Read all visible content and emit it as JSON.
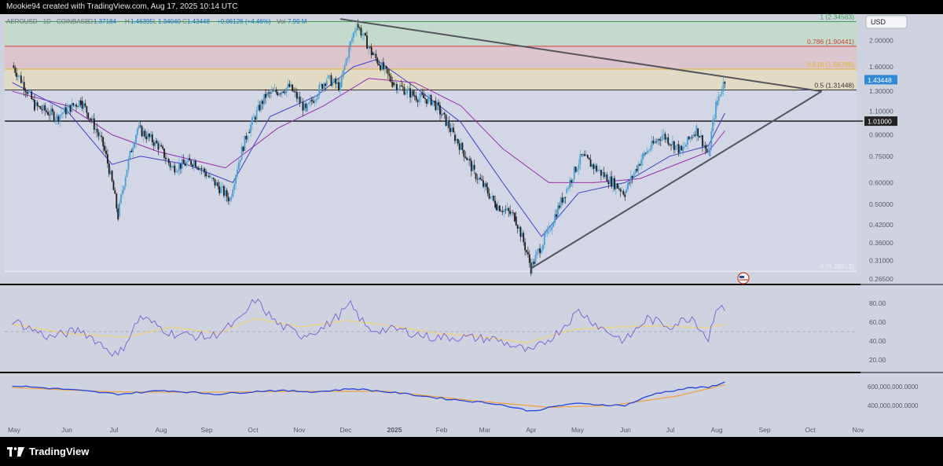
{
  "header": {
    "caption": "Mookie94 created with TradingView.com, Aug 17, 2025 10:14 UTC"
  },
  "symbol": {
    "name": "AEROUSD · 1D · COINBASE",
    "open_label": "O",
    "open": "1.37184",
    "high_label": "H",
    "high": "1.46395",
    "low_label": "L",
    "low": "1.34040",
    "close_label": "C",
    "close": "1.43448",
    "change": "+0.06126 (+4.46%)",
    "vol_label": "Vol",
    "vol": "7.99 M"
  },
  "currency": "USD",
  "footer": {
    "brand": "TradingView"
  },
  "colors": {
    "background": "#cfd3e0",
    "candle_up": "#4a9fd6",
    "candle_down": "#1c1c1c",
    "ma_short": "#4040c8",
    "ma_long": "#9a2db0",
    "trendline": "#55555e",
    "rsi": "#7a5cd6",
    "rsi_ma": "#f0d27a",
    "obv": "#2244e0",
    "obv_ma": "#f0a040",
    "price_tag": "#2f89d6"
  },
  "chart_data": {
    "type": "candlestick",
    "price_axis_labels": [
      "2.40000",
      "2.00000",
      "1.60000",
      "1.30000",
      "1.10000",
      "0.90000",
      "0.75000",
      "0.60000",
      "0.50000",
      "0.42000",
      "0.36000",
      "0.31000",
      "0.26500"
    ],
    "price_axis_values": [
      2.4,
      2.0,
      1.6,
      1.3,
      1.1,
      0.9,
      0.75,
      0.6,
      0.5,
      0.42,
      0.36,
      0.31,
      0.265
    ],
    "ylim": [
      0.26,
      2.45
    ],
    "log_scale": true,
    "last_price": "1.43448",
    "horizontal_level": {
      "label": "1.01000",
      "value": 1.01
    },
    "fib_levels": [
      {
        "label": "1 (2.34583)",
        "value": 2.34583,
        "color": "#3fa34d"
      },
      {
        "label": "0.786 (1.90441)",
        "value": 1.90441,
        "color": "#d0413c"
      },
      {
        "label": "0.618 (1.56788)",
        "value": 1.56788,
        "color": "#e0b630"
      },
      {
        "label": "0.5 (1.31448)",
        "value": 1.31448,
        "color": "#333333"
      },
      {
        "label": "0 (0.28313)",
        "value": 0.28313,
        "color": "#eeeeee"
      }
    ],
    "x_labels": [
      "May",
      "Jun",
      "Jul",
      "Aug",
      "Sep",
      "Oct",
      "Nov",
      "Dec",
      "2025",
      "Feb",
      "Mar",
      "Apr",
      "May",
      "Jun",
      "Jul",
      "Aug",
      "Sep",
      "Oct",
      "Nov"
    ],
    "price_series": [
      [
        "2024-04-25",
        1.62
      ],
      [
        "2024-05-10",
        1.15
      ],
      [
        "2024-05-25",
        1.05
      ],
      [
        "2024-06-10",
        1.2
      ],
      [
        "2024-06-25",
        0.82
      ],
      [
        "2024-07-05",
        0.45
      ],
      [
        "2024-07-18",
        0.95
      ],
      [
        "2024-08-01",
        0.82
      ],
      [
        "2024-08-10",
        0.68
      ],
      [
        "2024-08-25",
        0.72
      ],
      [
        "2024-09-05",
        0.62
      ],
      [
        "2024-09-18",
        0.52
      ],
      [
        "2024-09-30",
        0.92
      ],
      [
        "2024-10-12",
        1.25
      ],
      [
        "2024-10-28",
        1.35
      ],
      [
        "2024-11-08",
        1.1
      ],
      [
        "2024-11-22",
        1.45
      ],
      [
        "2024-12-01",
        1.35
      ],
      [
        "2024-12-12",
        2.3
      ],
      [
        "2024-12-22",
        1.8
      ],
      [
        "2025-01-05",
        1.4
      ],
      [
        "2025-01-20",
        1.25
      ],
      [
        "2025-02-01",
        1.2
      ],
      [
        "2025-02-15",
        0.9
      ],
      [
        "2025-03-01",
        0.65
      ],
      [
        "2025-03-15",
        0.5
      ],
      [
        "2025-03-28",
        0.45
      ],
      [
        "2025-04-08",
        0.29
      ],
      [
        "2025-04-20",
        0.4
      ],
      [
        "2025-05-01",
        0.55
      ],
      [
        "2025-05-12",
        0.75
      ],
      [
        "2025-05-25",
        0.65
      ],
      [
        "2025-06-10",
        0.55
      ],
      [
        "2025-06-22",
        0.75
      ],
      [
        "2025-07-05",
        0.9
      ],
      [
        "2025-07-18",
        0.78
      ],
      [
        "2025-07-28",
        0.95
      ],
      [
        "2025-08-05",
        0.75
      ],
      [
        "2025-08-10",
        1.15
      ],
      [
        "2025-08-16",
        1.43448
      ]
    ],
    "ma_short": [
      [
        "2024-04-25",
        1.4
      ],
      [
        "2024-06-01",
        1.1
      ],
      [
        "2024-07-01",
        0.7
      ],
      [
        "2024-07-20",
        0.75
      ],
      [
        "2024-08-20",
        0.7
      ],
      [
        "2024-09-20",
        0.6
      ],
      [
        "2024-10-15",
        1.05
      ],
      [
        "2024-11-15",
        1.25
      ],
      [
        "2024-12-10",
        1.6
      ],
      [
        "2024-12-25",
        1.7
      ],
      [
        "2025-01-20",
        1.35
      ],
      [
        "2025-02-20",
        1.0
      ],
      [
        "2025-03-20",
        0.6
      ],
      [
        "2025-04-15",
        0.38
      ],
      [
        "2025-05-10",
        0.55
      ],
      [
        "2025-06-10",
        0.6
      ],
      [
        "2025-07-10",
        0.75
      ],
      [
        "2025-08-05",
        0.82
      ],
      [
        "2025-08-16",
        1.08
      ]
    ],
    "ma_long": [
      [
        "2024-04-25",
        1.3
      ],
      [
        "2024-06-01",
        1.15
      ],
      [
        "2024-07-01",
        0.9
      ],
      [
        "2024-08-01",
        0.78
      ],
      [
        "2024-09-15",
        0.68
      ],
      [
        "2024-10-20",
        0.95
      ],
      [
        "2024-11-20",
        1.15
      ],
      [
        "2024-12-20",
        1.45
      ],
      [
        "2025-01-20",
        1.4
      ],
      [
        "2025-02-20",
        1.15
      ],
      [
        "2025-03-20",
        0.8
      ],
      [
        "2025-04-20",
        0.6
      ],
      [
        "2025-05-20",
        0.6
      ],
      [
        "2025-06-20",
        0.62
      ],
      [
        "2025-07-20",
        0.72
      ],
      [
        "2025-08-05",
        0.78
      ],
      [
        "2025-08-16",
        0.93
      ]
    ],
    "trendlines": [
      {
        "from": [
          "2024-12-01",
          2.4
        ],
        "to": [
          "2025-10-20",
          1.3
        ]
      },
      {
        "from": [
          "2025-04-08",
          0.29
        ],
        "to": [
          "2025-10-20",
          1.3
        ]
      }
    ],
    "rsi": {
      "axis_labels": [
        "80.00",
        "60.00",
        "40.00",
        "20.00"
      ],
      "axis_values": [
        80,
        60,
        40,
        20
      ],
      "ylim": [
        10,
        95
      ],
      "midline": 50,
      "series": [
        [
          "2024-04-25",
          62
        ],
        [
          "2024-05-20",
          44
        ],
        [
          "2024-06-10",
          52
        ],
        [
          "2024-07-05",
          24
        ],
        [
          "2024-07-20",
          66
        ],
        [
          "2024-08-10",
          48
        ],
        [
          "2024-09-05",
          44
        ],
        [
          "2024-09-25",
          62
        ],
        [
          "2024-10-05",
          84
        ],
        [
          "2024-10-20",
          58
        ],
        [
          "2024-11-05",
          46
        ],
        [
          "2024-11-20",
          54
        ],
        [
          "2024-12-08",
          78
        ],
        [
          "2024-12-20",
          52
        ],
        [
          "2025-01-10",
          52
        ],
        [
          "2025-01-30",
          44
        ],
        [
          "2025-02-20",
          44
        ],
        [
          "2025-03-15",
          42
        ],
        [
          "2025-04-08",
          28
        ],
        [
          "2025-04-25",
          48
        ],
        [
          "2025-05-10",
          72
        ],
        [
          "2025-05-25",
          54
        ],
        [
          "2025-06-10",
          40
        ],
        [
          "2025-06-25",
          64
        ],
        [
          "2025-07-10",
          56
        ],
        [
          "2025-07-25",
          66
        ],
        [
          "2025-08-05",
          42
        ],
        [
          "2025-08-10",
          76
        ],
        [
          "2025-08-16",
          72
        ]
      ],
      "ma_series": [
        [
          "2024-04-25",
          58
        ],
        [
          "2024-06-01",
          48
        ],
        [
          "2024-07-10",
          44
        ],
        [
          "2024-08-10",
          55
        ],
        [
          "2024-09-10",
          48
        ],
        [
          "2024-10-05",
          64
        ],
        [
          "2024-11-05",
          55
        ],
        [
          "2024-12-05",
          62
        ],
        [
          "2025-01-05",
          56
        ],
        [
          "2025-02-05",
          48
        ],
        [
          "2025-03-05",
          45
        ],
        [
          "2025-04-05",
          38
        ],
        [
          "2025-05-05",
          52
        ],
        [
          "2025-06-05",
          55
        ],
        [
          "2025-07-05",
          56
        ],
        [
          "2025-08-05",
          54
        ],
        [
          "2025-08-16",
          58
        ]
      ]
    },
    "obv": {
      "axis_labels": [
        "600,000,000.0000",
        "400,000,000.0000"
      ],
      "axis_values": [
        600000000,
        400000000
      ],
      "ylim": [
        250000000,
        700000000
      ],
      "series": [
        [
          "2024-04-25",
          610000000
        ],
        [
          "2024-06-01",
          570000000
        ],
        [
          "2024-07-05",
          520000000
        ],
        [
          "2024-08-05",
          560000000
        ],
        [
          "2024-09-10",
          520000000
        ],
        [
          "2024-10-15",
          560000000
        ],
        [
          "2024-11-15",
          545000000
        ],
        [
          "2024-12-10",
          580000000
        ],
        [
          "2025-01-10",
          530000000
        ],
        [
          "2025-02-10",
          470000000
        ],
        [
          "2025-03-15",
          420000000
        ],
        [
          "2025-04-08",
          340000000
        ],
        [
          "2025-05-05",
          420000000
        ],
        [
          "2025-06-10",
          400000000
        ],
        [
          "2025-07-01",
          530000000
        ],
        [
          "2025-07-25",
          590000000
        ],
        [
          "2025-08-05",
          590000000
        ],
        [
          "2025-08-16",
          650000000
        ]
      ],
      "ma_series": [
        [
          "2024-04-25",
          590000000
        ],
        [
          "2024-07-01",
          545000000
        ],
        [
          "2024-09-01",
          540000000
        ],
        [
          "2024-11-01",
          550000000
        ],
        [
          "2025-01-01",
          550000000
        ],
        [
          "2025-03-01",
          450000000
        ],
        [
          "2025-04-20",
          380000000
        ],
        [
          "2025-06-01",
          400000000
        ],
        [
          "2025-07-15",
          500000000
        ],
        [
          "2025-08-16",
          620000000
        ]
      ]
    }
  }
}
